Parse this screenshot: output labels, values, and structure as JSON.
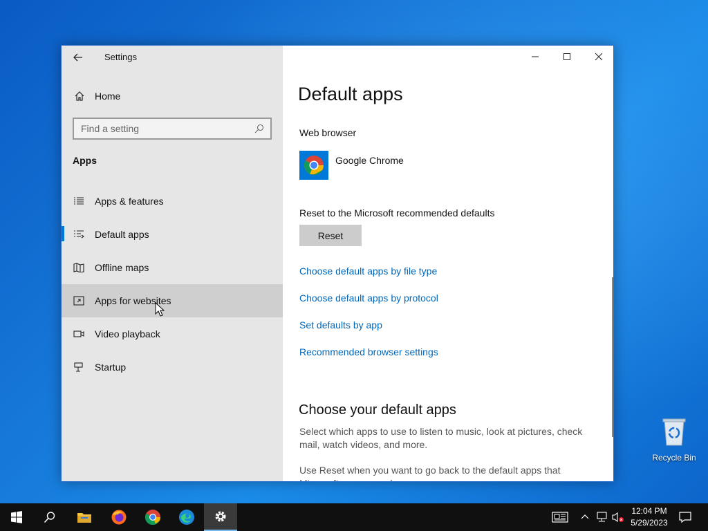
{
  "window": {
    "title": "Settings",
    "controls": {
      "minimize": "minimize",
      "maximize": "maximize",
      "close": "close"
    }
  },
  "nav": {
    "home_label": "Home",
    "search_placeholder": "Find a setting",
    "section": "Apps",
    "items": [
      {
        "label": "Apps & features",
        "icon": "list-icon",
        "selected": false
      },
      {
        "label": "Default apps",
        "icon": "list-arrow-icon",
        "selected": true
      },
      {
        "label": "Offline maps",
        "icon": "map-icon",
        "selected": false
      },
      {
        "label": "Apps for websites",
        "icon": "web-app-icon",
        "selected": false,
        "hovered": true
      },
      {
        "label": "Video playback",
        "icon": "video-icon",
        "selected": false
      },
      {
        "label": "Startup",
        "icon": "startup-icon",
        "selected": false
      }
    ]
  },
  "main": {
    "title": "Default apps",
    "web_browser_label": "Web browser",
    "web_browser_app": "Google Chrome",
    "reset_label": "Reset to the Microsoft recommended defaults",
    "reset_button": "Reset",
    "links": [
      "Choose default apps by file type",
      "Choose default apps by protocol",
      "Set defaults by app",
      "Recommended browser settings"
    ],
    "subheading": "Choose your default apps",
    "description1": "Select which apps to use to listen to music, look at pictures, check mail, watch videos, and more.",
    "description2": "Use Reset when you want to go back to the default apps that Microsoft recommends."
  },
  "desktop": {
    "recycle_bin_label": "Recycle Bin"
  },
  "taskbar": {
    "apps": [
      "start-icon",
      "search-icon",
      "file-explorer-icon",
      "firefox-icon",
      "chrome-icon",
      "edge-icon",
      "settings-icon"
    ],
    "active_app": "settings-icon",
    "time": "12:04 PM",
    "date": "5/29/2023"
  },
  "colors": {
    "accent": "#0078d7",
    "link": "#0067b8",
    "nav_bg": "#e6e6e6",
    "taskbar_bg": "#101010"
  }
}
